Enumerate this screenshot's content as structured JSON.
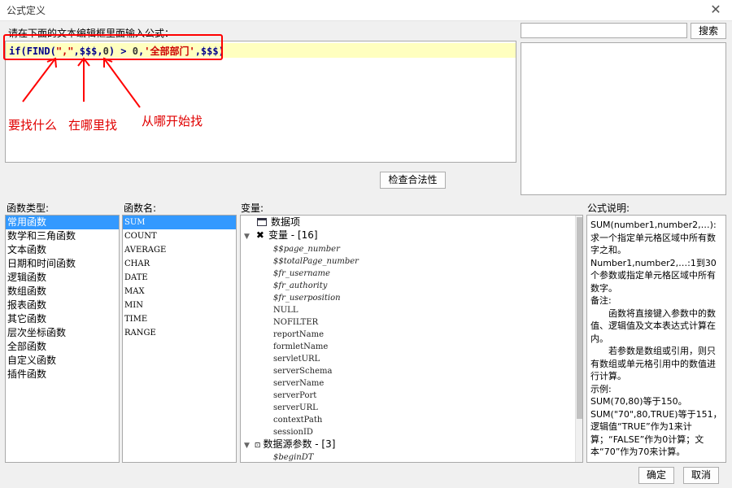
{
  "window": {
    "title": "公式定义",
    "close_icon": "close-icon"
  },
  "editor": {
    "instruction": "请在下面的文本编辑框里面输入公式：",
    "formula_fn1": "if(",
    "formula_fn2": "FIND(",
    "formula_str1": "\",\"",
    "formula_mid1": ",$$$,",
    "formula_num1": "0",
    "formula_mid2": ") > ",
    "formula_num2": "0",
    "formula_mid3": ",",
    "formula_str2": "'全部部门'",
    "formula_end": ",$$$)",
    "highlight_color": "#ffffbf"
  },
  "annotations": {
    "what": "要找什么",
    "where": "在哪里找",
    "from": "从哪开始找",
    "color": "#ff0000"
  },
  "search": {
    "value": "",
    "button": "搜索"
  },
  "validate_button": "检查合法性",
  "function_types": {
    "label": "函数类型:",
    "items": [
      "常用函数",
      "数学和三角函数",
      "文本函数",
      "日期和时间函数",
      "逻辑函数",
      "数组函数",
      "报表函数",
      "其它函数",
      "层次坐标函数",
      "全部函数",
      "自定义函数",
      "插件函数"
    ],
    "selected": "常用函数"
  },
  "function_names": {
    "label": "函数名:",
    "items": [
      "SUM",
      "COUNT",
      "AVERAGE",
      "CHAR",
      "DATE",
      "MAX",
      "MIN",
      "TIME",
      "RANGE"
    ],
    "selected": "SUM"
  },
  "variables": {
    "label": "变量:",
    "data_item": "数据项",
    "var_group": "变量 - [16]",
    "var_items": [
      "$$page_number",
      "$$totalPage_number",
      "$fr_username",
      "$fr_authority",
      "$fr_userposition",
      "NULL",
      "NOFILTER",
      "reportName",
      "formletName",
      "servletURL",
      "serverSchema",
      "serverName",
      "serverPort",
      "serverURL",
      "contextPath",
      "sessionID"
    ],
    "datasource_group": "数据源参数 - [3]",
    "datasource_items": [
      "$beginDT"
    ]
  },
  "description": {
    "label": "公式说明:",
    "lines": [
      "SUM(number1,number2,…): 求一个指定单元格区域中所有数字之和。",
      "Number1,number2,…:1到30个参数或指定单元格区域中所有数字。",
      "备注:",
      "　　函数将直接键入参数中的数值、逻辑值及文本表达式计算在内。",
      "　　若参数是数组或引用，则只有数组或单元格引用中的数值进行计算。",
      "示例:",
      "SUM(70,80)等于150。",
      "SUM(\"70\",80,TRUE)等于151，逻辑值“TRUE”作为1来计算；“FALSE”作为0计算；文本“70”作为70来计算。"
    ]
  },
  "footer": {
    "ok": "确定",
    "cancel": "取消"
  }
}
